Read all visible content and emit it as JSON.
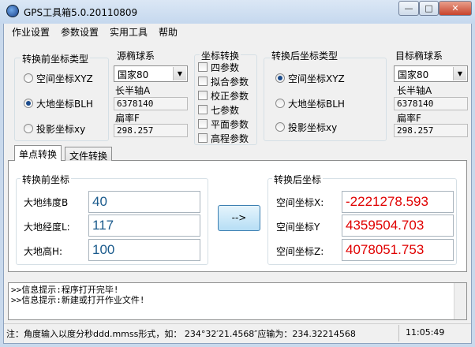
{
  "window": {
    "title": "GPS工具箱5.0.20110809",
    "min_glyph": "—",
    "max_glyph": "□",
    "close_glyph": "✕"
  },
  "menu": [
    "作业设置",
    "参数设置",
    "实用工具",
    "帮助"
  ],
  "source_coord_type": {
    "title": "转换前坐标类型",
    "options": [
      "空间坐标XYZ",
      "大地坐标BLH",
      "投影坐标xy"
    ],
    "selected_index": 1
  },
  "source_ellipsoid": {
    "title": "源椭球系",
    "selected": "国家80",
    "semi_major_label": "长半轴A",
    "semi_major_value": "6378140",
    "flattening_label": "扁率F",
    "flattening_value": "298.257"
  },
  "conversion": {
    "title": "坐标转换",
    "options": [
      "四参数",
      "拟合参数",
      "校正参数",
      "七参数",
      "平面参数",
      "高程参数"
    ]
  },
  "target_coord_type": {
    "title": "转换后坐标类型",
    "options": [
      "空间坐标XYZ",
      "大地坐标BLH",
      "投影坐标xy"
    ],
    "selected_index": 0
  },
  "target_ellipsoid": {
    "title": "目标椭球系",
    "selected": "国家80",
    "semi_major_label": "长半轴A",
    "semi_major_value": "6378140",
    "flattening_label": "扁率F",
    "flattening_value": "298.257"
  },
  "tabs": [
    "单点转换",
    "文件转换"
  ],
  "before": {
    "title": "转换前坐标",
    "lat_label": "大地纬度B",
    "lat_value": "40",
    "lon_label": "大地经度L:",
    "lon_value": "117",
    "height_label": "大地高H:",
    "height_value": "100"
  },
  "convert_button": "-->",
  "after": {
    "title": "转换后坐标",
    "x_label": "空间坐标X:",
    "x_value": "-2221278.593",
    "y_label": "空间坐标Y",
    "y_value": "4359504.703",
    "z_label": "空间坐标Z:",
    "z_value": "4078051.753"
  },
  "messages": [
    ">>信息提示:程序打开完毕!",
    ">>信息提示:新建或打开作业文件!"
  ],
  "status": {
    "hint": "注：角度输入以度分秒ddd.mmss形式，如： 234°32′21.4568″应输为：234.32214568",
    "time": "11:05:49"
  },
  "colors": {
    "accent_blue": "#1a5a8c",
    "result_red": "#e00000"
  }
}
